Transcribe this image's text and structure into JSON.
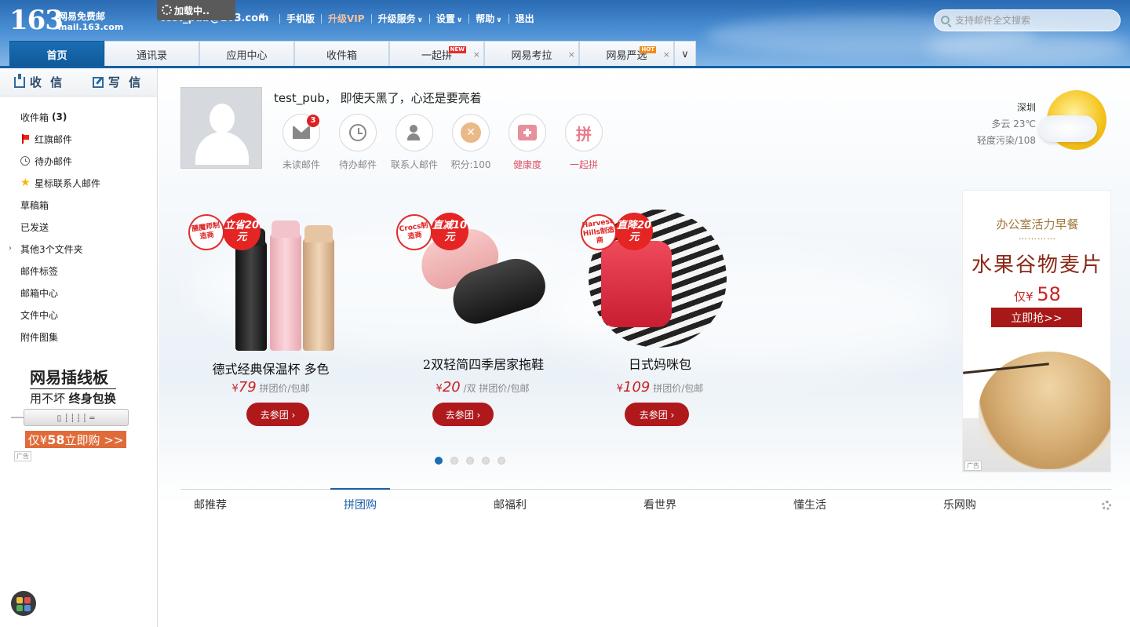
{
  "header": {
    "logo_number": "163",
    "logo_name": "网易免费邮",
    "logo_domain": "mail.163.com",
    "loading_text": "加载中..",
    "user_email": "test_pub@163.com",
    "nav": [
      {
        "label": "手机版"
      },
      {
        "label": "升级VIP"
      },
      {
        "label": "升级服务"
      },
      {
        "label": "设置"
      },
      {
        "label": "帮助"
      },
      {
        "label": "退出"
      }
    ],
    "search_placeholder": "支持邮件全文搜索",
    "tabs": [
      {
        "label": "首页",
        "active": true
      },
      {
        "label": "通讯录"
      },
      {
        "label": "应用中心"
      },
      {
        "label": "收件箱"
      },
      {
        "label": "一起拼",
        "badge": "NEW"
      },
      {
        "label": "网易考拉"
      },
      {
        "label": "网易严选",
        "badge": "HOT"
      }
    ],
    "tab_more_icon": "chevron-down-icon",
    "close_icon": "×"
  },
  "sidebar": {
    "receive_label": "收 信",
    "write_label": "写 信",
    "folders": [
      {
        "label": "收件箱",
        "count": "(3)"
      },
      {
        "label": "红旗邮件",
        "icon": "red-flag-icon"
      },
      {
        "label": "待办邮件",
        "icon": "clock-icon"
      },
      {
        "label": "星标联系人邮件",
        "icon": "star-icon"
      },
      {
        "label": "草稿箱"
      },
      {
        "label": "已发送"
      },
      {
        "label": "其他3个文件夹"
      },
      {
        "label": "邮件标签"
      },
      {
        "label": "邮箱中心"
      },
      {
        "label": "文件中心"
      },
      {
        "label": "附件图集"
      }
    ],
    "ad": {
      "title": "网易插线板",
      "subtitle_prefix": "用不坏",
      "subtitle_bold": "终身包换",
      "price_prefix": "仅¥",
      "price": "58",
      "price_suffix": " 立即购 >>",
      "ad_tag": "广告"
    }
  },
  "profile": {
    "greeting": "test_pub， 即使天黑了，心还是要亮着",
    "stats": [
      {
        "label": "未读邮件",
        "badge": "3",
        "icon": "mail-icon"
      },
      {
        "label": "待办邮件",
        "icon": "clock-icon"
      },
      {
        "label": "联系人邮件",
        "icon": "contact-star-icon"
      },
      {
        "label": "积分:100",
        "icon": "points-coin-icon"
      },
      {
        "label": "健康度",
        "icon": "health-kit-icon"
      },
      {
        "label": "一起拼",
        "icon": "pin-icon",
        "icon_text": "拼"
      }
    ]
  },
  "weather": {
    "city": "深圳",
    "condition": "多云 23℃",
    "pollution": "轻度污染/108",
    "icon": "sun-cloud-icon"
  },
  "products": [
    {
      "name": "德式经典保温杯 多色",
      "price": "79",
      "unit": "",
      "note": "拼团价/包邮",
      "button": "去参团 ›",
      "tag_maker": "膳魔师制造商",
      "tag_deal": "立省20元",
      "currency": "¥"
    },
    {
      "name": "2双轻简四季居家拖鞋",
      "price": "20",
      "unit": "/双",
      "note": "拼团价/包邮",
      "button": "去参团 ›",
      "tag_maker": "Crocs制造商",
      "tag_deal": "直减10元",
      "currency": "¥"
    },
    {
      "name": "日式妈咪包",
      "price": "109",
      "unit": "",
      "note": "拼团价/包邮",
      "button": "去参团 ›",
      "tag_maker": "Harvest Hills制造商",
      "tag_deal": "直降20元",
      "currency": "¥"
    }
  ],
  "carousel": {
    "pages": 5,
    "current": 1
  },
  "right_ad": {
    "line1": "办公室活力早餐",
    "dots": "…………",
    "title": "水果谷物麦片",
    "price_prefix": "仅¥",
    "price": "58",
    "button": "立即抢>>",
    "ad_tag": "广告"
  },
  "bottom_tabs": [
    {
      "label": "邮推荐"
    },
    {
      "label": "拼团购",
      "active": true
    },
    {
      "label": "邮福利"
    },
    {
      "label": "看世界"
    },
    {
      "label": "懂生活"
    },
    {
      "label": "乐网购"
    }
  ],
  "colors": {
    "brand_blue": "#1a6db3",
    "accent_red": "#b0191c",
    "vip": "#f5c2a3"
  }
}
